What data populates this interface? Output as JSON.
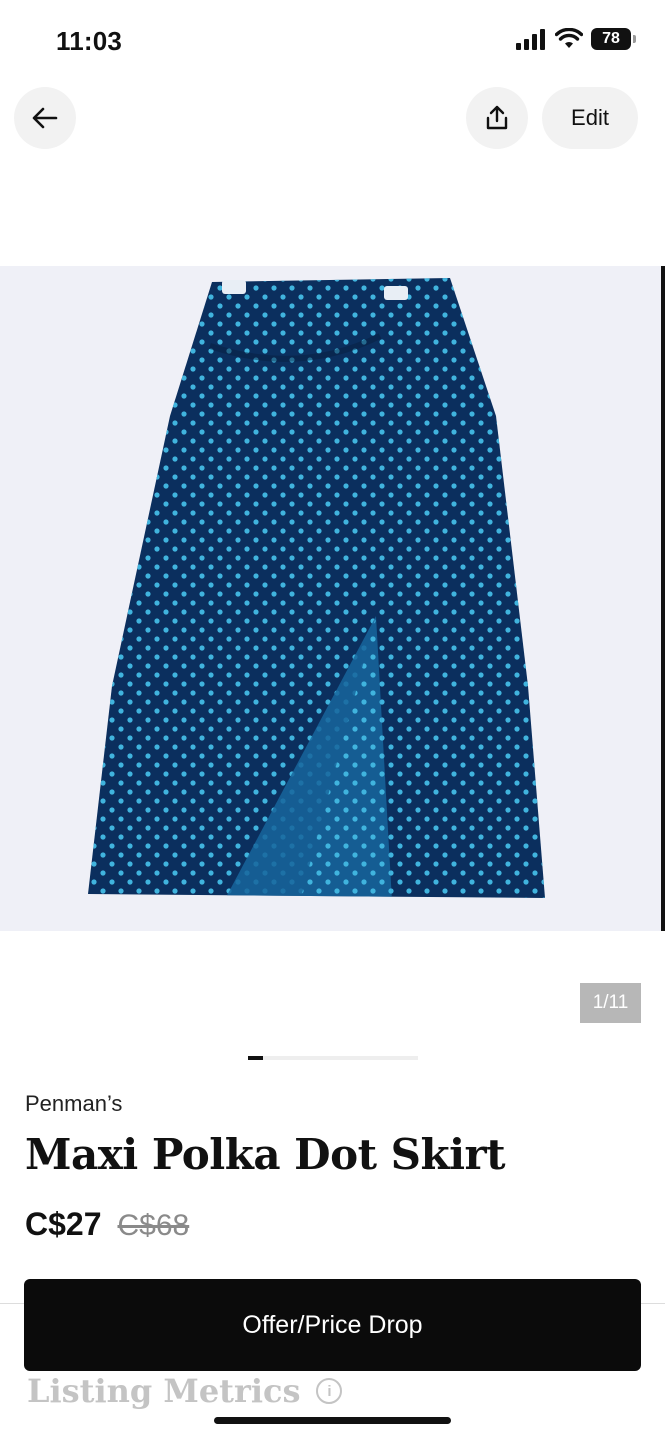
{
  "status_bar": {
    "time": "11:03",
    "battery": "78"
  },
  "header": {
    "edit_label": "Edit"
  },
  "gallery": {
    "counter": "1/11",
    "progress": 0.09
  },
  "listing": {
    "brand": "Penman’s",
    "title": "Maxi Polka Dot Skirt",
    "price": "C$27",
    "original_price": "C$68"
  },
  "actions": {
    "offer_label": "Offer/Price Drop"
  },
  "metrics": {
    "title": "Listing Metrics",
    "info_glyph": "i"
  },
  "icons": {
    "back": "arrow-left-icon",
    "share": "share-icon",
    "signal": "cellular-signal-icon",
    "wifi": "wifi-icon",
    "battery": "battery-icon",
    "info": "info-icon"
  },
  "colors": {
    "skirt": "#0b2f5e",
    "dots": "#40b4de",
    "button": "#0b0b0b",
    "photo_bg": "#eff0f7"
  }
}
